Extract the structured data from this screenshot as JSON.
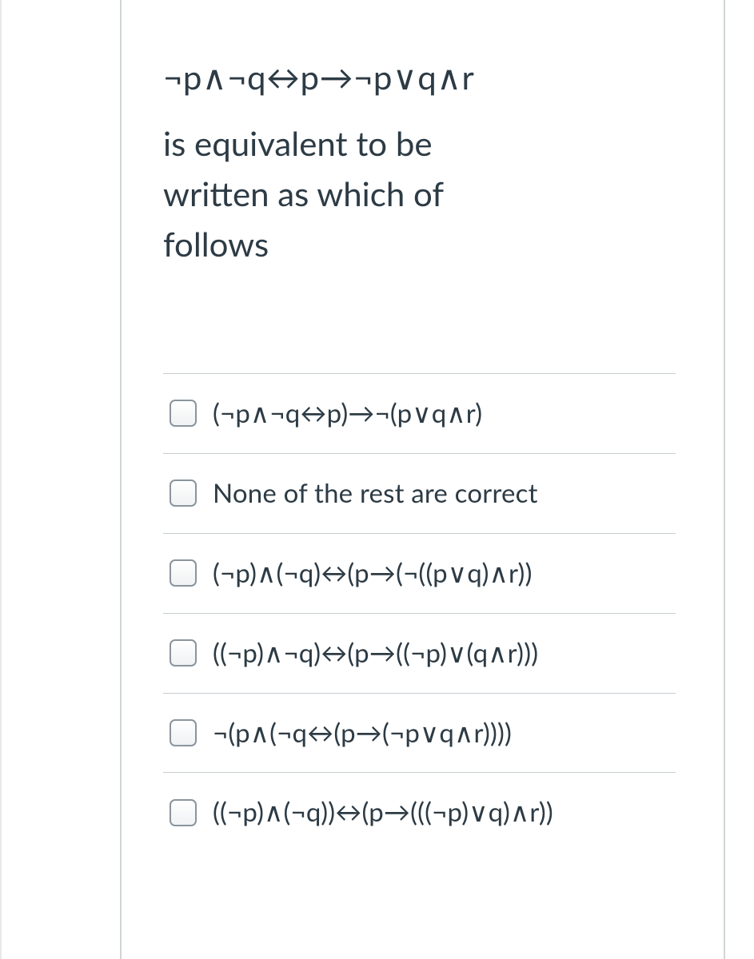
{
  "question": {
    "expression": "¬p∧¬q↔p→¬p∨q∧r",
    "prompt_line1": "is equivalent to be",
    "prompt_line2": "written as which of",
    "prompt_line3": "follows"
  },
  "options": [
    {
      "label": "(¬p∧¬q↔p)→¬(p∨q∧r)"
    },
    {
      "label": "None of the rest are correct"
    },
    {
      "label": "(¬p)∧(¬q)↔(p→(¬((p∨q)∧r))"
    },
    {
      "label": "((¬p)∧¬q)↔(p→((¬p)∨(q∧r)))"
    },
    {
      "label": "¬(p∧(¬q↔(p→(¬p∨q∧r))))"
    },
    {
      "label": "((¬p)∧(¬q))↔(p→(((¬p)∨q)∧r))"
    }
  ]
}
